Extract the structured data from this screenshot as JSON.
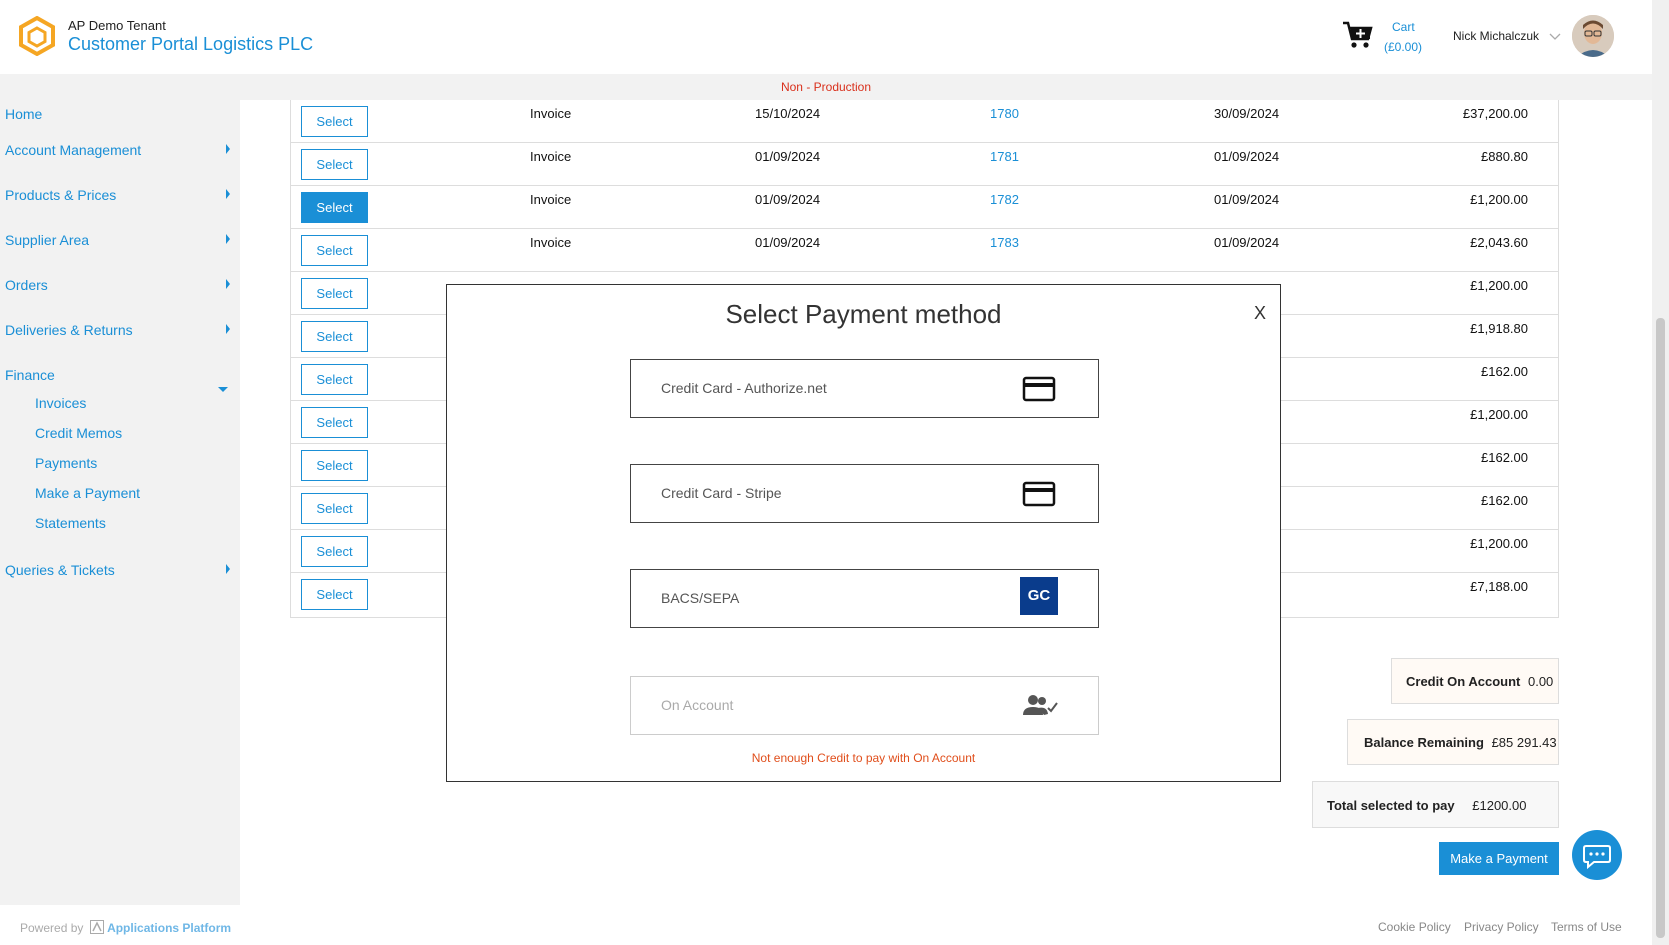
{
  "header": {
    "tenant": "AP Demo Tenant",
    "company": "Customer Portal Logistics PLC",
    "cart_label": "Cart",
    "cart_amount": "(£0.00)",
    "user_name": "Nick Michalczuk"
  },
  "env_banner": "Non - Production",
  "sidebar": {
    "items": [
      {
        "label": "Home"
      },
      {
        "label": "Account Management"
      },
      {
        "label": "Products & Prices"
      },
      {
        "label": "Supplier Area"
      },
      {
        "label": "Orders"
      },
      {
        "label": "Deliveries & Returns"
      },
      {
        "label": "Finance"
      },
      {
        "label": "Queries & Tickets"
      }
    ],
    "finance_sub": [
      {
        "label": "Invoices"
      },
      {
        "label": "Credit Memos"
      },
      {
        "label": "Payments"
      },
      {
        "label": "Make a Payment"
      },
      {
        "label": "Statements"
      }
    ]
  },
  "table": {
    "select_label": "Select",
    "rows": [
      {
        "type": "Invoice",
        "date1": "15/10/2024",
        "number": "1780",
        "date2": "30/09/2024",
        "amount": "£37,200.00"
      },
      {
        "type": "Invoice",
        "date1": "01/09/2024",
        "number": "1781",
        "date2": "01/09/2024",
        "amount": "£880.80"
      },
      {
        "type": "Invoice",
        "date1": "01/09/2024",
        "number": "1782",
        "date2": "01/09/2024",
        "amount": "£1,200.00",
        "selected": true
      },
      {
        "type": "Invoice",
        "date1": "01/09/2024",
        "number": "1783",
        "date2": "01/09/2024",
        "amount": "£2,043.60"
      },
      {
        "amount": "£1,200.00"
      },
      {
        "amount": "£1,918.80"
      },
      {
        "amount": "£162.00"
      },
      {
        "amount": "£1,200.00"
      },
      {
        "amount": "£162.00"
      },
      {
        "amount": "£162.00"
      },
      {
        "amount": "£1,200.00"
      },
      {
        "amount": "£7,188.00"
      }
    ]
  },
  "summary": {
    "credit_label": "Credit On Account",
    "credit_value": "0.00",
    "balance_label": "Balance Remaining",
    "balance_value": "£85 291.43",
    "total_label": "Total selected to pay",
    "total_value": "£1200.00",
    "pay_button": "Make a Payment"
  },
  "footer": {
    "powered_prefix": "Powered by",
    "powered_brand": "Applications Platform",
    "links": [
      "Cookie Policy",
      "Privacy Policy",
      "Terms of Use"
    ]
  },
  "modal": {
    "title": "Select Payment method",
    "close": "X",
    "options": [
      {
        "label": "Credit Card - Authorize.net",
        "icon": "credit-card-icon"
      },
      {
        "label": "Credit Card - Stripe",
        "icon": "credit-card-icon"
      },
      {
        "label": "BACS/SEPA",
        "icon": "gocardless-icon",
        "badge": "GC"
      },
      {
        "label": "On Account",
        "icon": "users-check-icon",
        "disabled": true
      }
    ],
    "warning": "Not enough Credit to pay with On Account"
  },
  "colors": {
    "accent": "#1a8fd6",
    "warning": "#e04e1b",
    "env": "#d9301c"
  }
}
